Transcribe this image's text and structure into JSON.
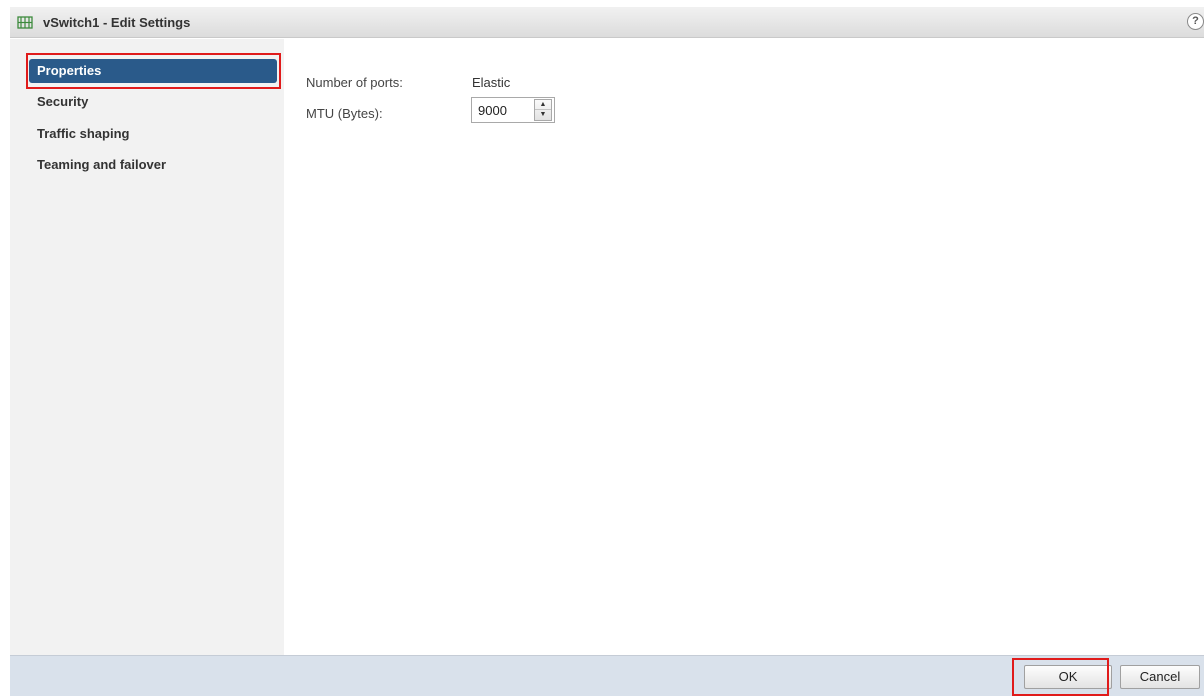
{
  "window": {
    "title": "vSwitch1 - Edit Settings",
    "icon": "vswitch-icon",
    "help_label": "?"
  },
  "sidebar": {
    "items": [
      {
        "label": "Properties",
        "selected": true
      },
      {
        "label": "Security",
        "selected": false
      },
      {
        "label": "Traffic shaping",
        "selected": false
      },
      {
        "label": "Teaming and failover",
        "selected": false
      }
    ]
  },
  "properties": {
    "ports_label": "Number of ports:",
    "ports_value": "Elastic",
    "mtu_label": "MTU (Bytes):",
    "mtu_value": "9000"
  },
  "footer": {
    "ok_label": "OK",
    "cancel_label": "Cancel"
  },
  "colors": {
    "selected_nav": "#2a5a8a",
    "highlight_box": "#e01b1b",
    "footer_bg": "#d9e1eb",
    "sidebar_bg": "#f2f2f2"
  }
}
